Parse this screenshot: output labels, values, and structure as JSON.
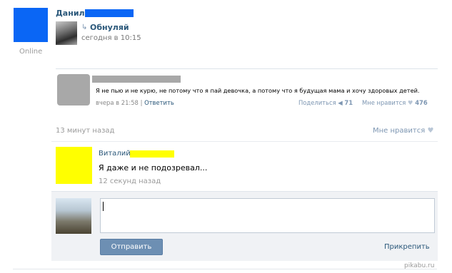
{
  "author": {
    "name": "Данил",
    "status": "Online"
  },
  "repost": {
    "name": "Обнуляй",
    "time": "сегодня в 10:15"
  },
  "quote": {
    "text": "Я не пью и не курю, не потому что я пай девочка, а потому что я будущая мама и хочу здоровых детей.",
    "date": "вчера в 21:58",
    "separator": "|",
    "reply_label": "Ответить",
    "share_label": "Поделиться",
    "share_count": "71",
    "like_label": "Мне нравится",
    "like_count": "476"
  },
  "post": {
    "ago": "13 минут назад",
    "like_label": "Мне нравится"
  },
  "comment": {
    "name": "Виталий",
    "text": "Я даже и не подозревал...",
    "time": "12 секунд назад"
  },
  "reply": {
    "input_value": "",
    "send_label": "Отправить",
    "attach_label": "Прикрепить"
  },
  "watermark": "pikabu.ru",
  "icons": {
    "repost": "repost-arrow-icon",
    "heart": "heart-icon",
    "share": "megaphone-icon"
  },
  "colors": {
    "link": "#2b587a",
    "censor_blue": "#0a66f5",
    "censor_yellow": "#ffff00",
    "button": "#6d8fb3"
  }
}
